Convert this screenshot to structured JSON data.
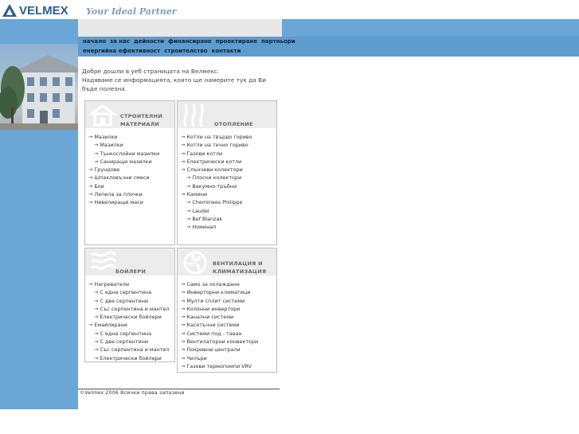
{
  "header": {
    "logo_text": "VELMEX",
    "tagline": "Your Ideal Partner"
  },
  "nav": {
    "row1": [
      "начало",
      "за нас",
      "дейности",
      "финансиране",
      "проектиране",
      "партньори"
    ],
    "row2": [
      "енергийна ефективност",
      "строителство",
      "контакти"
    ]
  },
  "intro": {
    "line1": "Добре дошли в уеб страницата на Велмекс.",
    "line2": "Надяваме се информацията, която ще намерите тук да Ви бъде полезна."
  },
  "sections": {
    "building": {
      "title1": "СТРОИТЕЛНИ",
      "title2": "МАТЕРИАЛИ",
      "items": [
        {
          "text": "→ Мазилки",
          "sub": false
        },
        {
          "text": "→ Мазилки",
          "sub": true
        },
        {
          "text": "→ Тънкослойни мазилки",
          "sub": true
        },
        {
          "text": "→ Саниращи мазилки",
          "sub": true
        },
        {
          "text": "→ Грундове",
          "sub": false
        },
        {
          "text": "→ Шпакловъчни смеси",
          "sub": false
        },
        {
          "text": "→ Бои",
          "sub": false
        },
        {
          "text": "→ Лепила за плочки",
          "sub": false
        },
        {
          "text": "→ Нивелиращи маси",
          "sub": false
        }
      ]
    },
    "heating": {
      "title1": "ОТОПЛЕНИЕ",
      "items": [
        {
          "text": "→ Котли на твърдо гориво",
          "sub": false
        },
        {
          "text": "→ Котли на течно гориво",
          "sub": false
        },
        {
          "text": "→ Газови котли",
          "sub": false
        },
        {
          "text": "→ Електрически котли",
          "sub": false
        },
        {
          "text": "→ Слънчеви колектори",
          "sub": false
        },
        {
          "text": "→ Плоски колектори",
          "sub": true
        },
        {
          "text": "→ Вакумно-тръбни",
          "sub": true
        },
        {
          "text": "→ Камини",
          "sub": false
        },
        {
          "text": "→ Cheminees Philippe",
          "sub": true
        },
        {
          "text": "→ Laudel",
          "sub": true
        },
        {
          "text": "→ Bef Blanzak",
          "sub": true
        },
        {
          "text": "→ Номинал",
          "sub": true
        }
      ]
    },
    "boilers": {
      "title1": "БОЙЛЕРИ",
      "items": [
        {
          "text": "→ Нагреватели",
          "sub": false
        },
        {
          "text": "→ С една серпентина",
          "sub": true
        },
        {
          "text": "→ С две серпентини",
          "sub": true
        },
        {
          "text": "→ Със серпентина и мантел",
          "sub": true
        },
        {
          "text": "→ Електрически бойлери",
          "sub": true
        },
        {
          "text": "→ Емайлирани",
          "sub": false
        },
        {
          "text": "→ С една серпентина",
          "sub": true
        },
        {
          "text": "→ С две серпентини",
          "sub": true
        },
        {
          "text": "→ Със серпентина и мантел",
          "sub": true
        },
        {
          "text": "→ Електрически бойлери",
          "sub": true
        }
      ]
    },
    "ventilation": {
      "title1": "ВЕНТИЛАЦИЯ И",
      "title2": "КЛИМАТИЗАЦИЯ",
      "items": [
        {
          "text": "→ Само за охлаждане",
          "sub": false
        },
        {
          "text": "→ Инверторни климатици",
          "sub": false
        },
        {
          "text": "→ Мулти сплит системи",
          "sub": false
        },
        {
          "text": "→ Колонни инвертори",
          "sub": false
        },
        {
          "text": "→ Канални системи",
          "sub": false
        },
        {
          "text": "→ Касетъчни системи",
          "sub": false
        },
        {
          "text": "→ Системи под - таван",
          "sub": false
        },
        {
          "text": "→ Вентилаторни конвектори",
          "sub": false
        },
        {
          "text": "→ Покривни централи",
          "sub": false
        },
        {
          "text": "→ Чилъри",
          "sub": false
        },
        {
          "text": "→ Газови термопомпи VRV",
          "sub": false
        }
      ]
    }
  },
  "footer": {
    "copyright": "©Velmex 2006 Всички права запазени"
  },
  "colors": {
    "sidebar_blue": "#6aa6d6",
    "nav_blue": "#5e9ccd",
    "logo_blue": "#2b5d95"
  }
}
